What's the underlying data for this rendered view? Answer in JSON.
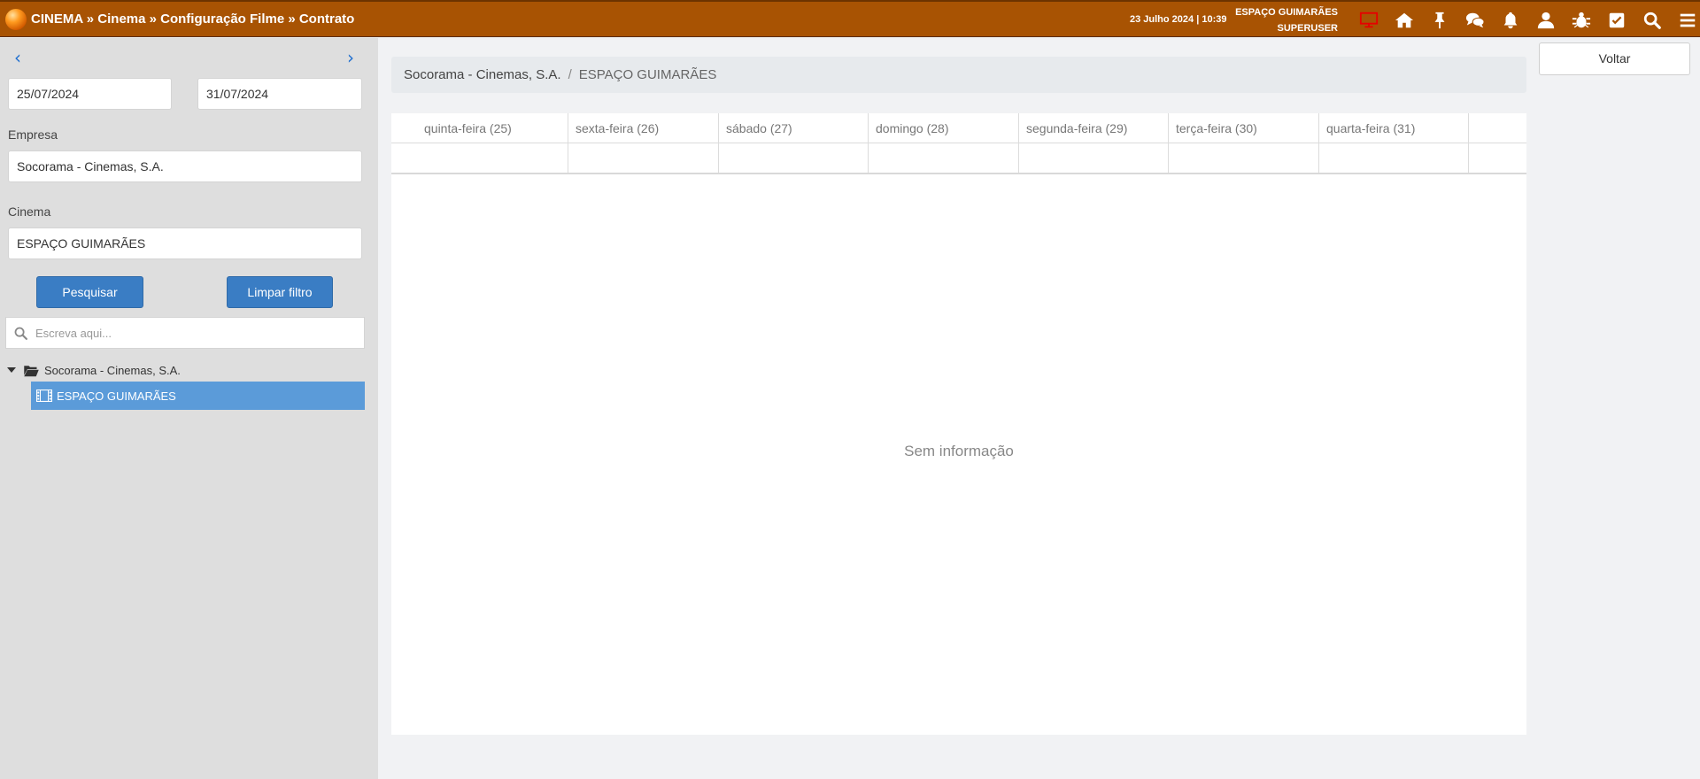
{
  "header": {
    "breadcrumb": "CINEMA » Cinema » Configuração Filme » Contrato",
    "datetime": "23 Julho 2024 | 10:39",
    "location": "ESPAÇO GUIMARÃES",
    "user": "SUPERUSER",
    "icons": [
      "monitor-icon",
      "home-icon",
      "pin-icon",
      "chat-icon",
      "bell-icon",
      "user-icon",
      "bug-icon",
      "checkbox-icon",
      "search-icon",
      "menu-icon"
    ],
    "colors": {
      "bar": "#a85303",
      "monitor_icon": "#e60000"
    }
  },
  "sidebar": {
    "date_from": "25/07/2024",
    "date_to": "31/07/2024",
    "empresa_label": "Empresa",
    "empresa_value": "Socorama - Cinemas, S.A.",
    "cinema_label": "Cinema",
    "cinema_value": "ESPAÇO GUIMARÃES",
    "search_button": "Pesquisar",
    "clear_button": "Limpar filtro",
    "filter_placeholder": "Escreva aqui...",
    "tree": {
      "root": "Socorama - Cinemas, S.A.",
      "selected_child": "ESPAÇO GUIMARÃES"
    }
  },
  "main": {
    "breadcrumb": {
      "company": "Socorama - Cinemas, S.A.",
      "separator": "/",
      "cinema": "ESPAÇO GUIMARÃES"
    },
    "days": [
      "quinta-feira (25)",
      "sexta-feira (26)",
      "sábado (27)",
      "domingo (28)",
      "segunda-feira (29)",
      "terça-feira (30)",
      "quarta-feira (31)"
    ],
    "empty_message": "Sem informação"
  },
  "back_button": "Voltar"
}
